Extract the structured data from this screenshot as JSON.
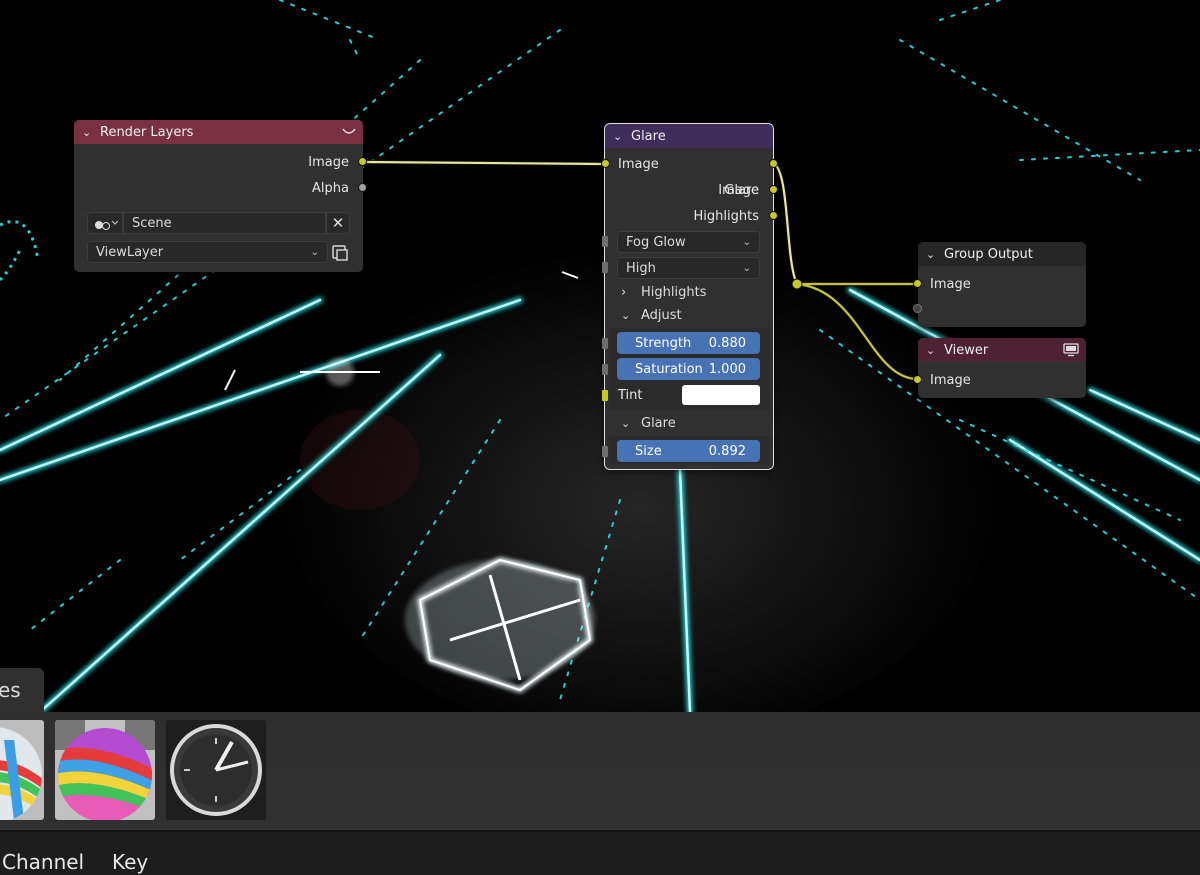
{
  "nodes": {
    "render_layers": {
      "title": "Render Layers",
      "outputs": [
        "Image",
        "Alpha"
      ],
      "scene_value": "Scene",
      "view_layer_value": "ViewLayer"
    },
    "glare": {
      "title": "Glare",
      "input_label": "Image",
      "outputs": [
        "Image",
        "Glare",
        "Highlights"
      ],
      "glare_type": "Fog Glow",
      "quality": "High",
      "highlights_panel": "Highlights",
      "adjust_panel": "Adjust",
      "strength": {
        "label": "Strength",
        "value": "0.880"
      },
      "saturation": {
        "label": "Saturation",
        "value": "1.000"
      },
      "tint_label": "Tint",
      "tint_color": "#ffffff",
      "glare_panel": "Glare",
      "size": {
        "label": "Size",
        "value": "0.892"
      }
    },
    "group_output": {
      "title": "Group Output",
      "input_label": "Image"
    },
    "viewer": {
      "title": "Viewer",
      "input_label": "Image"
    }
  },
  "asset_browser": {
    "tab_label": "es",
    "thumbnails": [
      "striped-sphere-material",
      "striped-sphere-material",
      "clock-icon"
    ]
  },
  "menu": [
    "Channel",
    "Key"
  ],
  "colors": {
    "render_layers_header": "#7a3043",
    "glare_header": "#3e2c5a",
    "group_output_header": "#262626",
    "viewer_header": "#4e2233",
    "socket_image": "#c7c729",
    "slider": "#4772b3",
    "wire": "#e8e69a"
  }
}
